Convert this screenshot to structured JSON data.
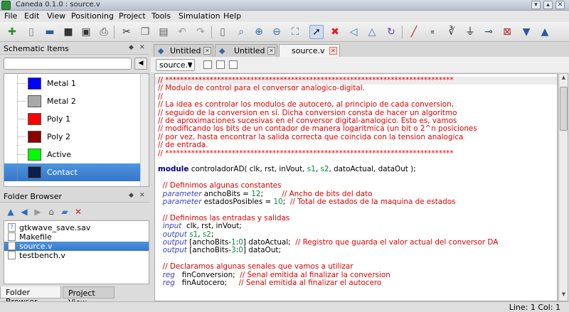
{
  "window": {
    "title": "Caneda 0.1.0 : source.v"
  },
  "menu": [
    "File",
    "Edit",
    "View",
    "Positioning",
    "Project",
    "Tools",
    "Simulation",
    "Help"
  ],
  "toolbar": {
    "icons": [
      "new-file-icon",
      "new-document-icon",
      "open-icon",
      "save-icon",
      "save-all-icon",
      "print-icon",
      "cut-icon",
      "copy-icon",
      "paste-icon",
      "undo-icon",
      "redo-icon",
      "text-file-icon",
      "zoom-icon",
      "zoom-in-icon",
      "zoom-out-icon",
      "zoom-fit-icon",
      "select-arrow-icon",
      "delete-icon",
      "mirror-x-icon",
      "mirror-y-icon",
      "rotate-icon",
      "wire-icon",
      "name-icon",
      "equation-icon",
      "ground-icon",
      "port-icon",
      "component-icon",
      "probe-icon",
      "simulate-icon"
    ],
    "colors": {
      "delete": "#e02020",
      "accent": "#3f74b9"
    }
  },
  "schematic_items": {
    "title": "Schematic Items",
    "layers": [
      {
        "name": "Metal 1",
        "color": "#0000ff"
      },
      {
        "name": "Metal 2",
        "color": "#a9a9a9"
      },
      {
        "name": "Poly 1",
        "color": "#ff0000"
      },
      {
        "name": "Poly 2",
        "color": "#8b0000"
      },
      {
        "name": "Active",
        "color": "#00ff00"
      },
      {
        "name": "Contact",
        "color": "#0b1f4a"
      }
    ],
    "selected": "Contact"
  },
  "folder_browser": {
    "title": "Folder Browser",
    "files": [
      "gtkwave_save.sav",
      "Makefile",
      "source.v",
      "testbench.v"
    ],
    "selected": "source.v",
    "bottom_tabs": [
      "Folder Browser",
      "Project View"
    ]
  },
  "editor": {
    "tabs": [
      "Untitled",
      "Untitled",
      "source.v"
    ],
    "active_tab": "source.v",
    "file_combo": "source.v",
    "lines": [
      [
        {
          "t": "// ******************************************************************************",
          "c": "com"
        }
      ],
      [
        {
          "t": "// Modulo de control para el conversor analogico-digital.",
          "c": "com"
        }
      ],
      [
        {
          "t": "//",
          "c": "com"
        }
      ],
      [
        {
          "t": "// La idea es controlar los modulos de autocero, al principio de cada conversion,",
          "c": "com"
        }
      ],
      [
        {
          "t": "// seguido de la conversion en sí. Dicha conversion consta de hacer un algoritmo",
          "c": "com"
        }
      ],
      [
        {
          "t": "// de aproximaciones sucesivas en el conversor digital-analogico. Esto es, vamos",
          "c": "com"
        }
      ],
      [
        {
          "t": "// modificando los bits de un contador de manera logaritmica (un bit o 2^n posiciones",
          "c": "com"
        }
      ],
      [
        {
          "t": "// por vez, hasta encontrar la salida correcta que coincida con la tension analogica",
          "c": "com"
        }
      ],
      [
        {
          "t": "// de entrada.",
          "c": "com"
        }
      ],
      [
        {
          "t": "// ******************************************************************************",
          "c": "com"
        }
      ],
      [],
      [
        {
          "t": "module",
          "c": "kw"
        },
        {
          "t": " controladorAD( clk, rst, inVout, ",
          "c": "txt"
        },
        {
          "t": "s1",
          "c": "num"
        },
        {
          "t": ", ",
          "c": "txt"
        },
        {
          "t": "s2",
          "c": "num"
        },
        {
          "t": ", datoActual, dataOut );",
          "c": "txt"
        }
      ],
      [],
      [
        {
          "t": "  // Definimos algunas constantes",
          "c": "com"
        }
      ],
      [
        {
          "t": "  ",
          "c": "txt"
        },
        {
          "t": "parameter",
          "c": "ty"
        },
        {
          "t": " anchoBits = ",
          "c": "txt"
        },
        {
          "t": "12",
          "c": "num"
        },
        {
          "t": ";        ",
          "c": "txt"
        },
        {
          "t": "// Ancho de bits del dato",
          "c": "com"
        }
      ],
      [
        {
          "t": "  ",
          "c": "txt"
        },
        {
          "t": "parameter",
          "c": "ty"
        },
        {
          "t": " estadosPosibles = ",
          "c": "txt"
        },
        {
          "t": "10",
          "c": "num"
        },
        {
          "t": ";  ",
          "c": "txt"
        },
        {
          "t": "// Total de estados de la maquina de estados",
          "c": "com"
        }
      ],
      [],
      [
        {
          "t": "  // Definimos las entradas y salidas",
          "c": "com"
        }
      ],
      [
        {
          "t": "  ",
          "c": "txt"
        },
        {
          "t": "input",
          "c": "ty"
        },
        {
          "t": "  clk, rst, inVout;",
          "c": "txt"
        }
      ],
      [
        {
          "t": "  ",
          "c": "txt"
        },
        {
          "t": "output",
          "c": "ty"
        },
        {
          "t": " ",
          "c": "txt"
        },
        {
          "t": "s1",
          "c": "num"
        },
        {
          "t": ", ",
          "c": "txt"
        },
        {
          "t": "s2",
          "c": "num"
        },
        {
          "t": ";",
          "c": "txt"
        }
      ],
      [
        {
          "t": "  ",
          "c": "txt"
        },
        {
          "t": "output",
          "c": "ty"
        },
        {
          "t": " [anchoBits-",
          "c": "txt"
        },
        {
          "t": "1",
          "c": "num"
        },
        {
          "t": ":",
          "c": "txt"
        },
        {
          "t": "0",
          "c": "num"
        },
        {
          "t": "] datoActual;  ",
          "c": "txt"
        },
        {
          "t": "// Registro que guarda el valor actual del conversor DA",
          "c": "com"
        }
      ],
      [
        {
          "t": "  ",
          "c": "txt"
        },
        {
          "t": "output",
          "c": "ty"
        },
        {
          "t": " [anchoBits-",
          "c": "txt"
        },
        {
          "t": "3",
          "c": "num"
        },
        {
          "t": ":",
          "c": "txt"
        },
        {
          "t": "0",
          "c": "num"
        },
        {
          "t": "] dataOut;",
          "c": "txt"
        }
      ],
      [],
      [
        {
          "t": "  // Declaramos algunas senales que vamos a utilizar",
          "c": "com"
        }
      ],
      [
        {
          "t": "  ",
          "c": "txt"
        },
        {
          "t": "reg",
          "c": "ty"
        },
        {
          "t": "   finConversion;  ",
          "c": "txt"
        },
        {
          "t": "// Senal emitida al finalizar la conversion",
          "c": "com"
        }
      ],
      [
        {
          "t": "  ",
          "c": "txt"
        },
        {
          "t": "reg",
          "c": "ty"
        },
        {
          "t": "   finAutocero;     ",
          "c": "txt"
        },
        {
          "t": "// Senal emitida al finalizar el autocero",
          "c": "com"
        }
      ]
    ]
  },
  "status": {
    "position": "Line: 1 Col: 1"
  }
}
